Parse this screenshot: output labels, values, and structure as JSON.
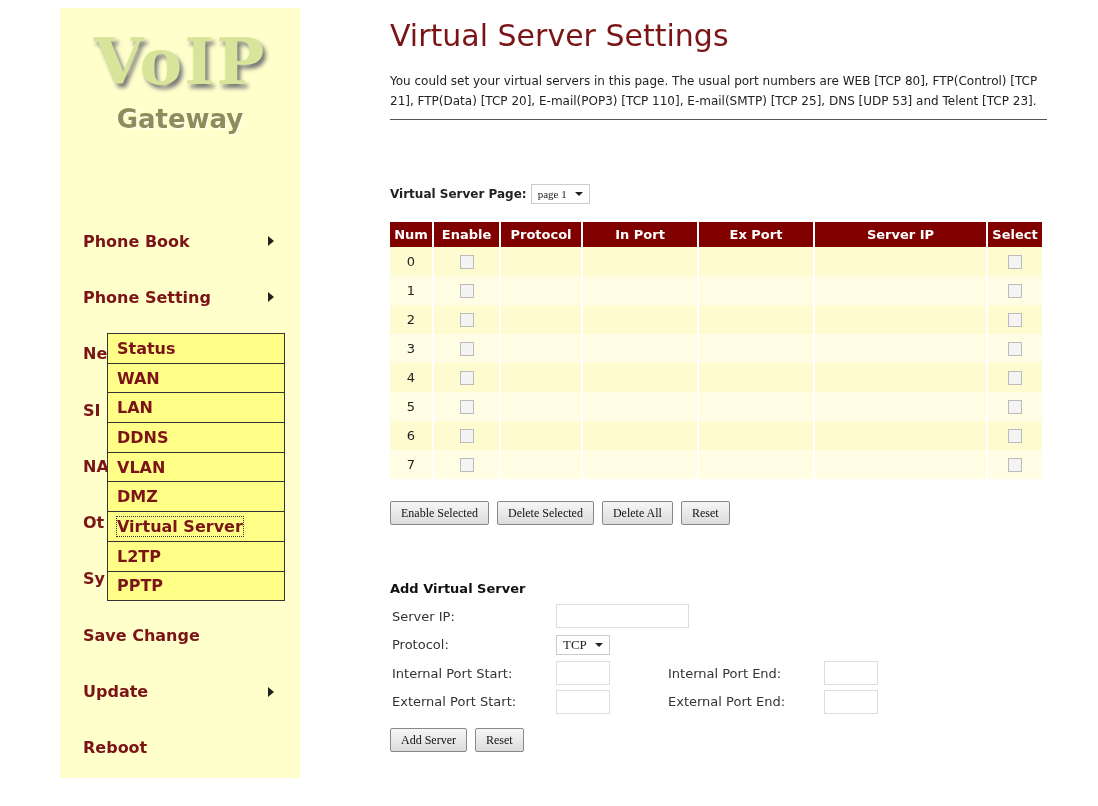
{
  "logo": {
    "title": "VoIP",
    "subtitle": "Gateway"
  },
  "sidebar": {
    "items": [
      {
        "label": "Phone Book",
        "submenu": true
      },
      {
        "label": "Phone Setting",
        "submenu": true
      },
      {
        "label": "Ne",
        "submenu": false
      },
      {
        "label": "SI",
        "submenu": false
      },
      {
        "label": "NA",
        "submenu": false
      },
      {
        "label": "Ot",
        "submenu": false
      },
      {
        "label": "Sy",
        "submenu": false
      },
      {
        "label": "Save Change",
        "submenu": false
      },
      {
        "label": "Update",
        "submenu": true
      },
      {
        "label": "Reboot",
        "submenu": false
      }
    ]
  },
  "dropdown_menu": {
    "items": [
      {
        "label": "Status",
        "selected": false
      },
      {
        "label": "WAN",
        "selected": false
      },
      {
        "label": "LAN",
        "selected": false
      },
      {
        "label": "DDNS",
        "selected": false
      },
      {
        "label": "VLAN",
        "selected": false
      },
      {
        "label": "DMZ",
        "selected": false
      },
      {
        "label": "Virtual Server",
        "selected": true
      },
      {
        "label": "L2TP",
        "selected": false
      },
      {
        "label": "PPTP",
        "selected": false
      }
    ]
  },
  "title": "Virtual Server Settings",
  "description": "You could set your virtual servers in this page. The usual port numbers are WEB [TCP 80], FTP(Control) [TCP 21], FTP(Data) [TCP 20], E-mail(POP3) [TCP 110], E-mail(SMTP) [TCP 25], DNS [UDP 53] and Telent [TCP 23].",
  "page_selector": {
    "label": "Virtual Server Page:",
    "value": "page 1"
  },
  "table": {
    "columns": [
      "Num",
      "Enable",
      "Protocol",
      "In Port",
      "Ex Port",
      "Server IP",
      "Select"
    ],
    "rows": [
      {
        "num": "0",
        "enabled": false,
        "selected": false
      },
      {
        "num": "1",
        "enabled": false,
        "selected": false
      },
      {
        "num": "2",
        "enabled": false,
        "selected": false
      },
      {
        "num": "3",
        "enabled": false,
        "selected": false
      },
      {
        "num": "4",
        "enabled": false,
        "selected": false
      },
      {
        "num": "5",
        "enabled": false,
        "selected": false
      },
      {
        "num": "6",
        "enabled": false,
        "selected": false
      },
      {
        "num": "7",
        "enabled": false,
        "selected": false
      }
    ]
  },
  "table_buttons": [
    "Enable Selected",
    "Delete Selected",
    "Delete All",
    "Reset"
  ],
  "add_form": {
    "title": "Add Virtual Server",
    "server_ip_label": "Server IP:",
    "protocol_label": "Protocol:",
    "protocol_value": "TCP",
    "internal_start_label": "Internal Port Start:",
    "internal_end_label": "Internal Port End:",
    "external_start_label": "External Port Start:",
    "external_end_label": "External Port End:",
    "buttons": [
      "Add Server",
      "Reset"
    ]
  }
}
